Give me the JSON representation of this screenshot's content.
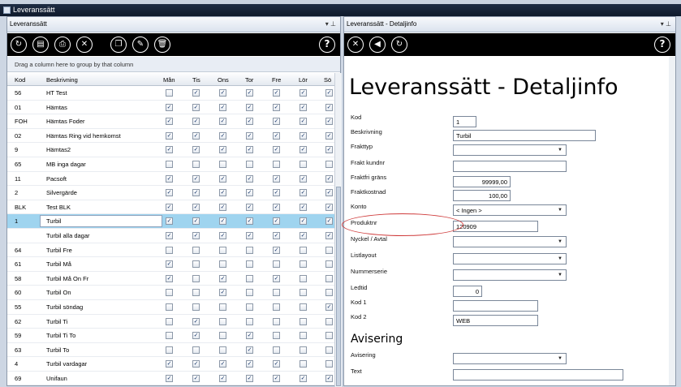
{
  "window": {
    "title": "Leveranssätt"
  },
  "left_panel": {
    "title": "Leveranssätt",
    "pin": "▾ ⊥",
    "groupby_hint": "Drag a column here to group by that column",
    "toolbar_icons": [
      "refresh-icon",
      "new-record-icon",
      "print-icon",
      "export-excel-icon",
      "copy-icon",
      "edit-icon",
      "delete-icon"
    ],
    "columns": [
      "Kod",
      "Beskrivning",
      "Mån",
      "Tis",
      "Ons",
      "Tor",
      "Fre",
      "Lör",
      "Sö"
    ],
    "rows": [
      {
        "kod": "56",
        "besk": "HT Test",
        "days": [
          0,
          1,
          1,
          1,
          1,
          1,
          1
        ]
      },
      {
        "kod": "01",
        "besk": "Hämtas",
        "days": [
          1,
          1,
          1,
          1,
          1,
          1,
          1
        ]
      },
      {
        "kod": "FOH",
        "besk": "Hämtas Foder",
        "days": [
          1,
          1,
          1,
          1,
          1,
          1,
          1
        ]
      },
      {
        "kod": "02",
        "besk": "Hämtas Ring vid hemkomst",
        "days": [
          1,
          1,
          1,
          1,
          1,
          1,
          1
        ]
      },
      {
        "kod": "9",
        "besk": "Hämtas2",
        "days": [
          1,
          1,
          1,
          1,
          1,
          1,
          1
        ]
      },
      {
        "kod": "65",
        "besk": "MB inga dagar",
        "days": [
          0,
          0,
          0,
          0,
          0,
          0,
          0
        ]
      },
      {
        "kod": "11",
        "besk": "Pacsoft",
        "days": [
          1,
          1,
          1,
          1,
          1,
          1,
          1
        ]
      },
      {
        "kod": "2",
        "besk": "Silvergärde",
        "days": [
          1,
          1,
          1,
          1,
          1,
          1,
          1
        ]
      },
      {
        "kod": "BLK",
        "besk": "Test BLK",
        "days": [
          1,
          1,
          1,
          1,
          1,
          1,
          1
        ]
      },
      {
        "kod": "1",
        "besk": "Turbil",
        "days": [
          1,
          1,
          1,
          1,
          1,
          1,
          1
        ],
        "selected": true
      },
      {
        "kod": "",
        "besk": "Turbil alla dagar",
        "days": [
          1,
          1,
          1,
          1,
          1,
          1,
          1
        ]
      },
      {
        "kod": "64",
        "besk": "Turbil Fre",
        "days": [
          0,
          0,
          0,
          0,
          1,
          0,
          0
        ]
      },
      {
        "kod": "61",
        "besk": "Turbil Må",
        "days": [
          1,
          0,
          0,
          0,
          0,
          0,
          0
        ]
      },
      {
        "kod": "58",
        "besk": "Turbil Må On Fr",
        "days": [
          1,
          0,
          1,
          0,
          1,
          0,
          0
        ]
      },
      {
        "kod": "60",
        "besk": "Turbil On",
        "days": [
          0,
          0,
          1,
          0,
          0,
          0,
          0
        ]
      },
      {
        "kod": "55",
        "besk": "Turbil söndag",
        "days": [
          0,
          0,
          0,
          0,
          0,
          0,
          1
        ]
      },
      {
        "kod": "62",
        "besk": "Turbil Ti",
        "days": [
          0,
          1,
          0,
          0,
          0,
          0,
          0
        ]
      },
      {
        "kod": "59",
        "besk": "Turbil Ti To",
        "days": [
          0,
          1,
          0,
          1,
          0,
          0,
          0
        ]
      },
      {
        "kod": "63",
        "besk": "Turbil To",
        "days": [
          0,
          0,
          0,
          1,
          0,
          0,
          0
        ]
      },
      {
        "kod": "4",
        "besk": "Turbil vardagar",
        "days": [
          1,
          1,
          1,
          1,
          1,
          0,
          0
        ]
      },
      {
        "kod": "69",
        "besk": "Unifaun",
        "days": [
          1,
          1,
          1,
          1,
          1,
          1,
          1
        ]
      }
    ],
    "check_glyph": "✓"
  },
  "right_panel": {
    "title": "Leveranssätt - Detaljinfo",
    "pin": "▾ ⊥",
    "toolbar_icons": [
      "close-icon",
      "back-icon",
      "refresh-icon"
    ],
    "heading": "Leveranssätt - Detaljinfo",
    "labels": {
      "kod": "Kod",
      "beskrivning": "Beskrivning",
      "frakttyp": "Frakttyp",
      "frakt_kundnr": "Frakt kundnr",
      "fraktfri_grans": "Fraktfri gräns",
      "fraktkostnad": "Fraktkostnad",
      "konto": "Konto",
      "produktnr": "Produktnr",
      "nyckel": "Nyckel / Avtal",
      "listlayout": "Listlayout",
      "nummerserie": "Nummerserie",
      "ledtid": "Ledtid",
      "kod1": "Kod 1",
      "kod2": "Kod 2",
      "avisering": "Avisering",
      "text": "Text"
    },
    "values": {
      "kod": "1",
      "beskrivning": "Turbil",
      "frakttyp": "",
      "frakt_kundnr": "",
      "fraktfri_grans": "99999,00",
      "fraktkostnad": "100,00",
      "konto": "< Ingen >",
      "produktnr": "120909",
      "nyckel": "",
      "listlayout": "",
      "nummerserie": "",
      "ledtid": "0",
      "kod1": "",
      "kod2": "WEB",
      "avisering": "",
      "text": ""
    },
    "section_avisering": "Avisering"
  },
  "colors": {
    "toolbar": "#000000",
    "selected_row": "#9fd4ef",
    "highlight_ellipse": "#cf3b3b"
  }
}
